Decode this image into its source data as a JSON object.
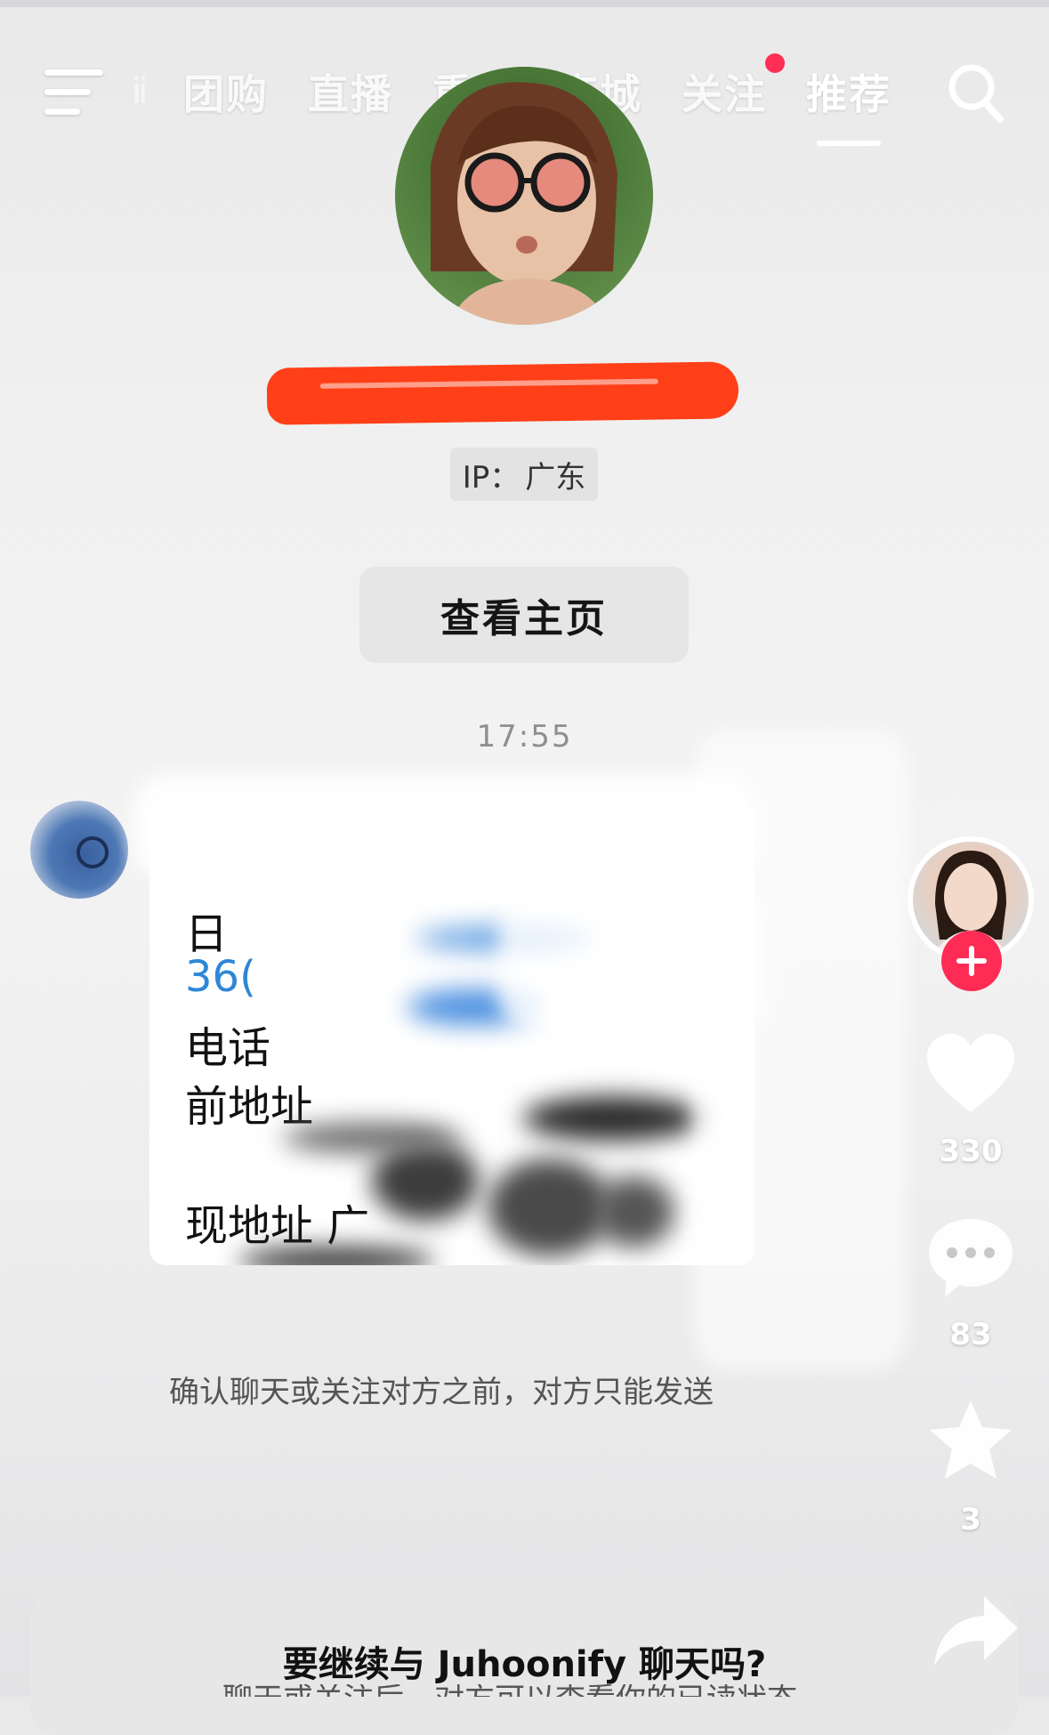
{
  "nav": {
    "faded_tab": "ⅱ",
    "tabs": [
      {
        "label": "团购"
      },
      {
        "label": "直播"
      },
      {
        "label": "重庆"
      },
      {
        "label": "商城"
      },
      {
        "label": "关注"
      },
      {
        "label": "推荐"
      }
    ],
    "active_tab": "推荐",
    "notification_dot_color": "#ff2e55"
  },
  "profile": {
    "ip_label": "IP：",
    "ip_region": "广东",
    "view_homepage_label": "查看主页"
  },
  "chat": {
    "timestamp": "17:55",
    "message_lines": [
      "日",
      "36(",
      "电话",
      "前地址",
      "现地址 广"
    ],
    "notice": "确认聊天或关注对方之前，对方只能发送"
  },
  "side_actions": {
    "likes": "330",
    "comments": "83",
    "favorites": "3"
  },
  "sheet": {
    "title": "要继续与 Juhoonify 聊天吗?",
    "subtitle": "聊天或关注后，对方可以查看你的已读状态"
  },
  "colors": {
    "accent_red": "#fe2c55",
    "redaction": "#ff3f17",
    "link_blue": "#2e86d6"
  }
}
